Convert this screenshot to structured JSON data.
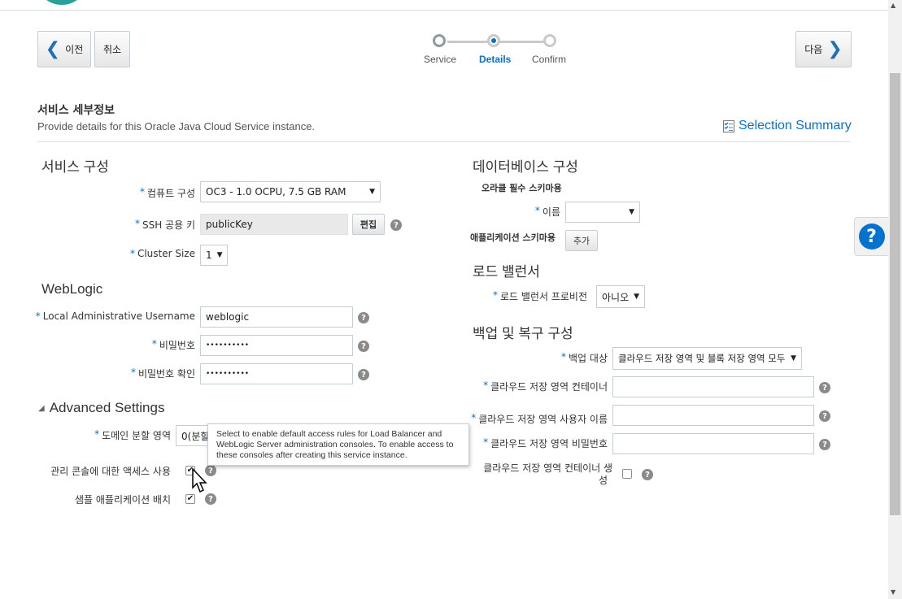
{
  "nav": {
    "prev_label": "이전",
    "cancel_label": "취소",
    "next_label": "다음"
  },
  "train": {
    "steps": [
      {
        "label": "Service",
        "state": "visited"
      },
      {
        "label": "Details",
        "state": "current"
      },
      {
        "label": "Confirm",
        "state": "unvisited"
      }
    ]
  },
  "header": {
    "title": "서비스 세부정보",
    "description": "Provide details for this Oracle Java Cloud Service instance.",
    "summary_link": "Selection Summary"
  },
  "service_config": {
    "section_title": "서비스 구성",
    "compute_label": "컴퓨트 구성",
    "compute_value": "OC3 - 1.0 OCPU, 7.5 GB RAM",
    "ssh_label": "SSH 공용 키",
    "ssh_value": "publicKey",
    "ssh_edit": "편집",
    "cluster_label": "Cluster Size",
    "cluster_value": "1"
  },
  "weblogic": {
    "section_title": "WebLogic",
    "username_label": "Local Administrative Username",
    "username_value": "weblogic",
    "password_label": "비밀번호",
    "password_value": "••••••••••",
    "confirm_label": "비밀번호 확인",
    "confirm_value": "••••••••••"
  },
  "advanced": {
    "section_title": "Advanced Settings",
    "domain_label": "도메인 분할 영역",
    "domain_value": "0(분할",
    "console_label": "관리 콘솔에 대한 액세스 사용",
    "sample_label": "샘플 애플리케이션 배치",
    "tooltip": "Select to enable default access rules for Load Balancer and WebLogic Server administration consoles. To enable access to these consoles after creating this service instance."
  },
  "database": {
    "section_title": "데이터베이스 구성",
    "oracle_schema_label": "오라클 필수 스키마용",
    "name_label": "이름",
    "name_value": "",
    "app_schema_label": "애플리케이션 스키마용",
    "add_label": "추가"
  },
  "load_balancer": {
    "section_title": "로드 밸런서",
    "provision_label": "로드 밸런서 프로비전",
    "provision_value": "아니오"
  },
  "backup": {
    "section_title": "백업 및 복구 구성",
    "target_label": "백업 대상",
    "target_value": "클라우드 저장 영역 및 블록 저장 영역 모두",
    "container_label": "클라우드 저장 영역 컨테이너",
    "user_label": "클라우드 저장 영역 사용자 이름",
    "password_label": "클라우드 저장 영역 비밀번호",
    "create_label_line1": "클라우드 저장 영역 컨테이너 생",
    "create_label_line2": "성"
  },
  "icons": {
    "prev": "chevron-left-icon",
    "next": "chevron-right-icon",
    "help": "question-icon",
    "summary": "checklist-icon",
    "expand": "triangle-down-icon"
  },
  "colors": {
    "accent": "#0572ce",
    "required": "#0572ce"
  }
}
